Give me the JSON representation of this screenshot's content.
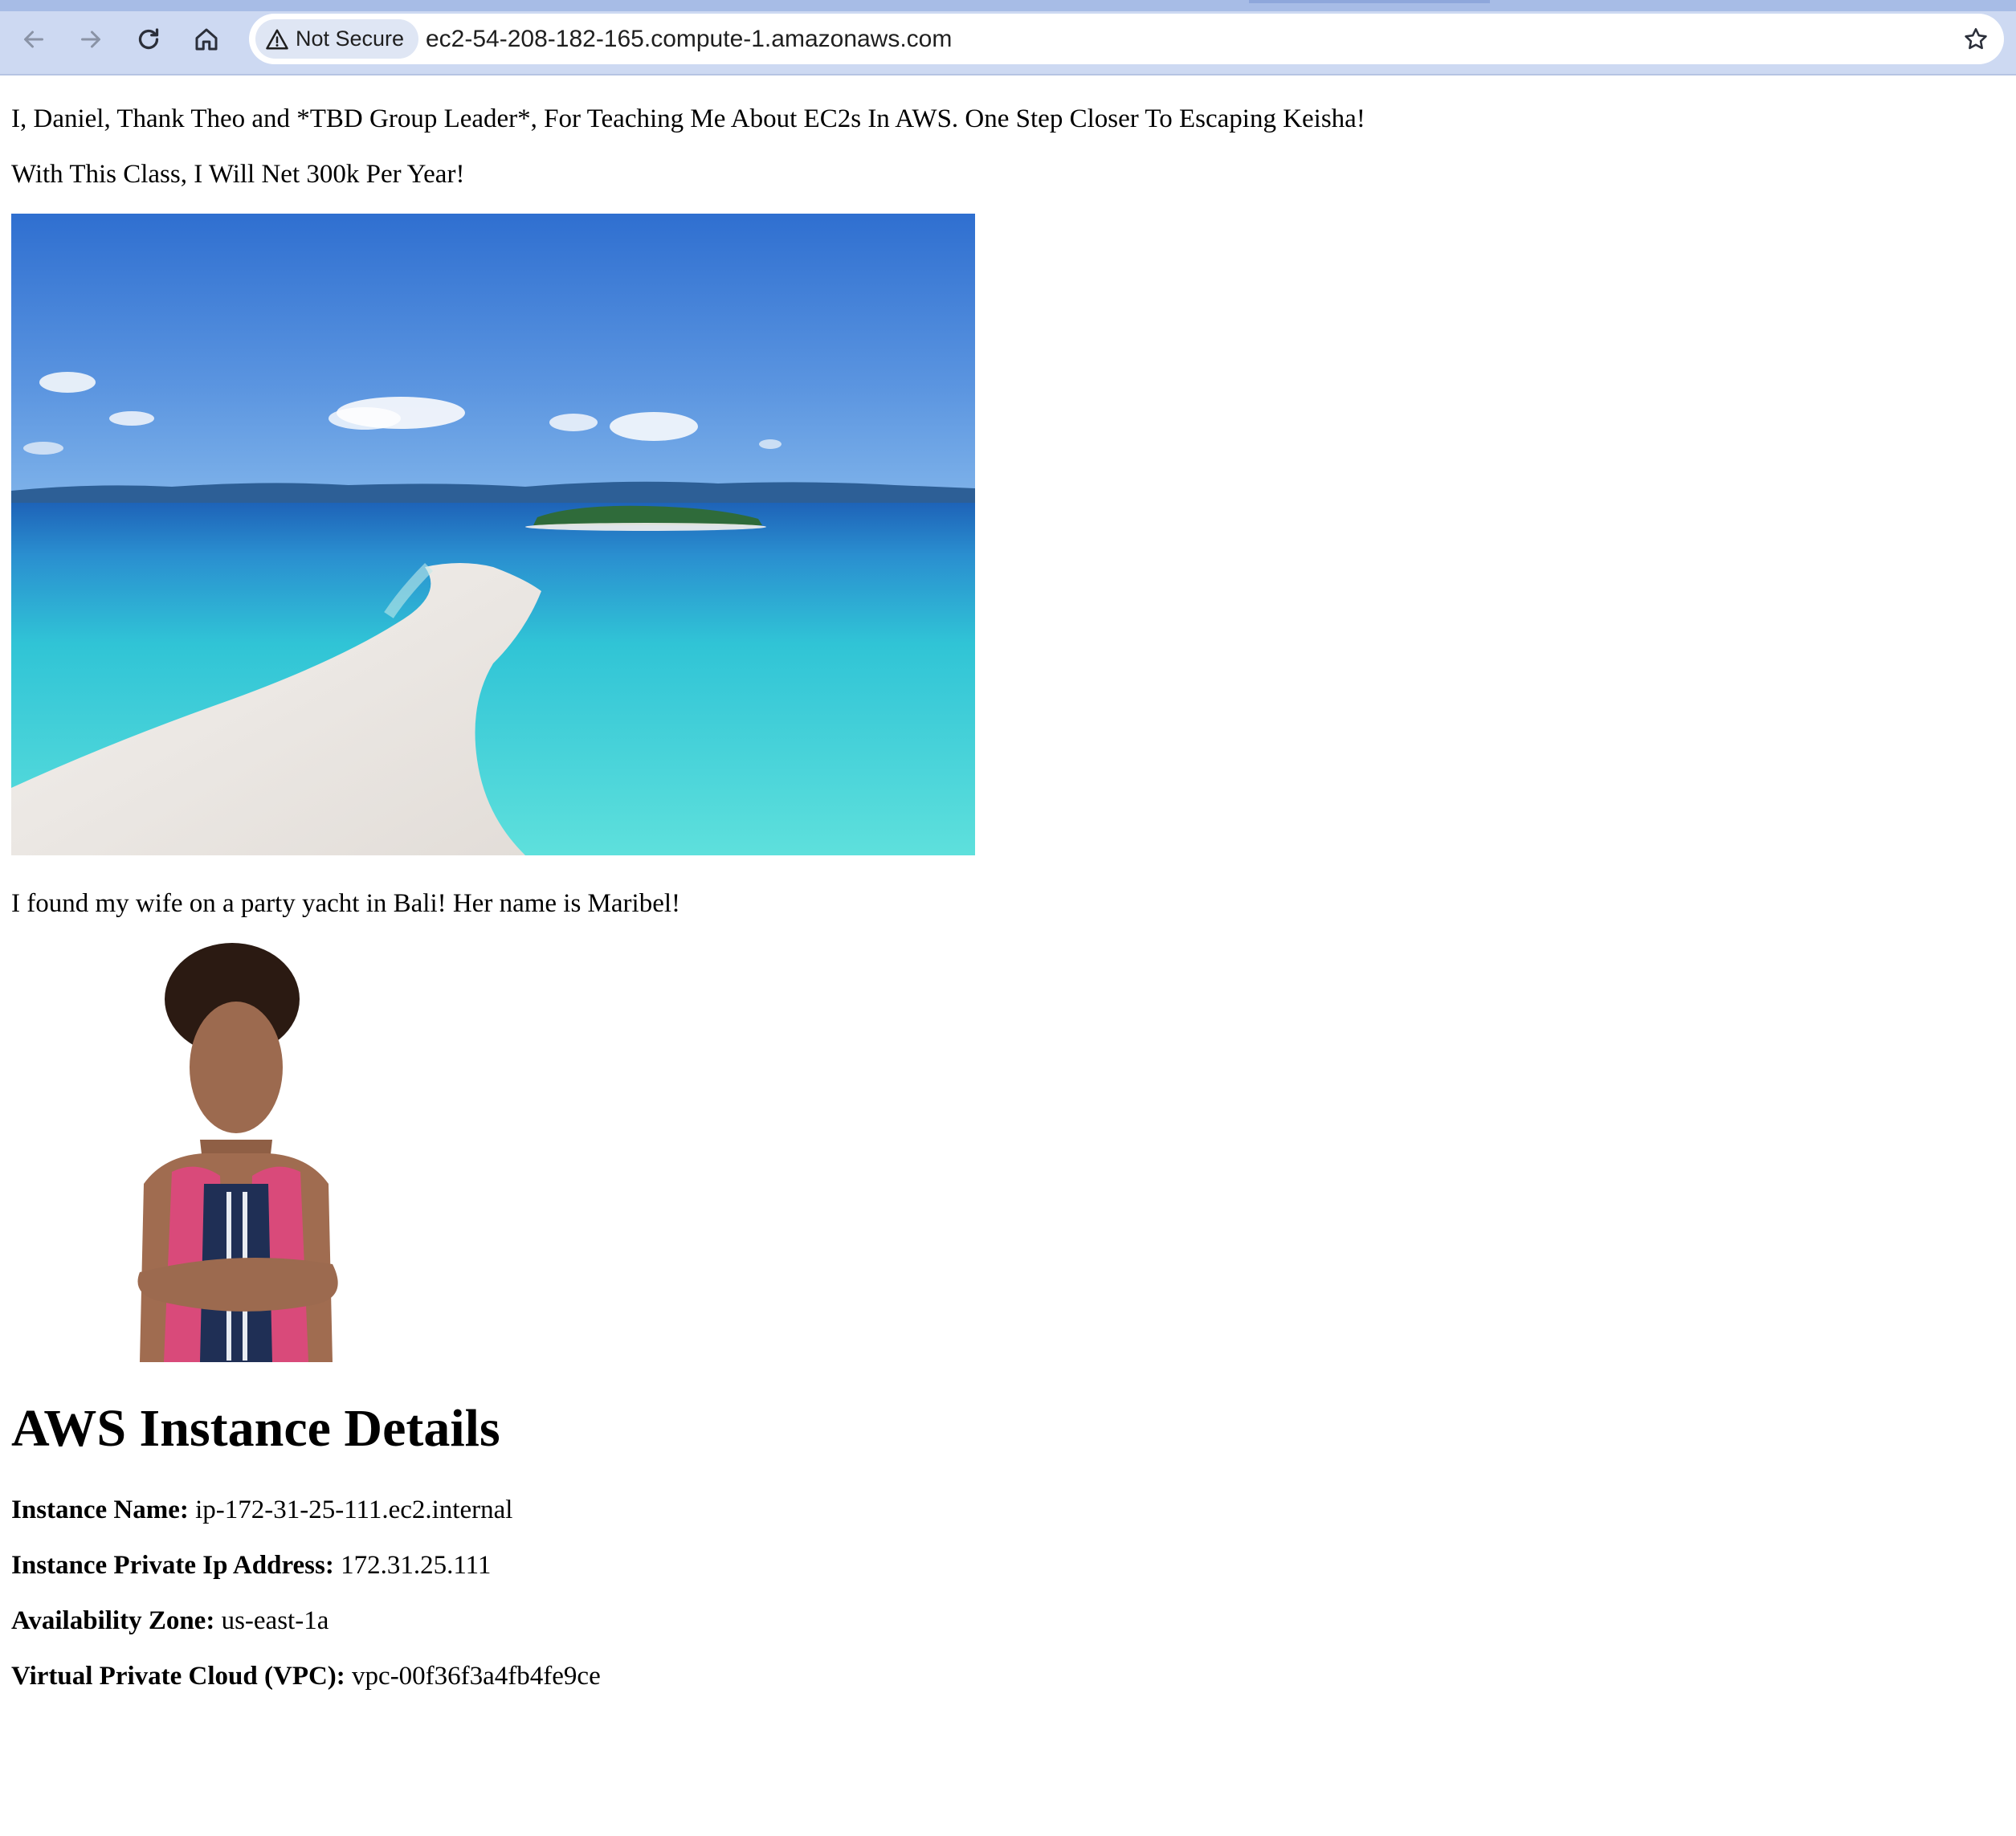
{
  "browser": {
    "security_label": "Not Secure",
    "url": "ec2-54-208-182-165.compute-1.amazonaws.com",
    "icons": [
      "back-arrow-icon",
      "forward-arrow-icon",
      "reload-icon",
      "home-icon",
      "warning-icon",
      "star-icon"
    ]
  },
  "content": {
    "thanks_line": "I, Daniel, Thank Theo and *TBD Group Leader*, For Teaching Me About EC2s In AWS. One Step Closer To Escaping Keisha!",
    "salary_line": "With This Class, I Will Net 300k Per Year!",
    "wife_line": "I found my wife on a party yacht in Bali! Her name is Maribel!",
    "heading": "AWS Instance Details",
    "details": [
      {
        "label": "Instance Name:",
        "value": "ip-172-31-25-111.ec2.internal"
      },
      {
        "label": "Instance Private Ip Address:",
        "value": "172.31.25.111"
      },
      {
        "label": "Availability Zone:",
        "value": "us-east-1a"
      },
      {
        "label": "Virtual Private Cloud (VPC):",
        "value": "vpc-00f36f3a4fb4fe9ce"
      }
    ]
  },
  "colors": {
    "toolbar": "#cdd9f2",
    "sky": "#3f7fd6",
    "water": "#2fc9d3",
    "sand": "#ece8e4"
  }
}
